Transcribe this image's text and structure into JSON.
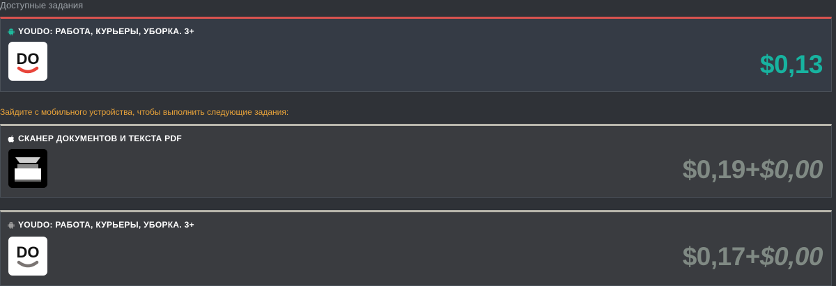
{
  "section_title": "Доступные задания",
  "notice": "Зайдите с мобильного устройства, чтобы выполнить следующие задания:",
  "colors": {
    "active_accent": "#d9534f",
    "active_price": "#17b3a0",
    "inactive_price": "#808a84",
    "notice": "#e8a33a"
  },
  "tasks": [
    {
      "platform_icon": "android-icon",
      "title": "YOUDO: РАБОТА, КУРЬЕРЫ, УБОРКА. 3+",
      "logo_text": "DO",
      "price": "$0,13"
    },
    {
      "platform_icon": "apple-icon",
      "title": "СКАНЕР ДОКУМЕНТОВ И ТЕКСТА PDF",
      "price_main": "$0,19+",
      "price_bonus": "$0,00"
    },
    {
      "platform_icon": "android-icon",
      "title": "YOUDO: РАБОТА, КУРЬЕРЫ, УБОРКА. 3+",
      "logo_text": "DO",
      "price_main": "$0,17+",
      "price_bonus": "$0,00"
    }
  ]
}
